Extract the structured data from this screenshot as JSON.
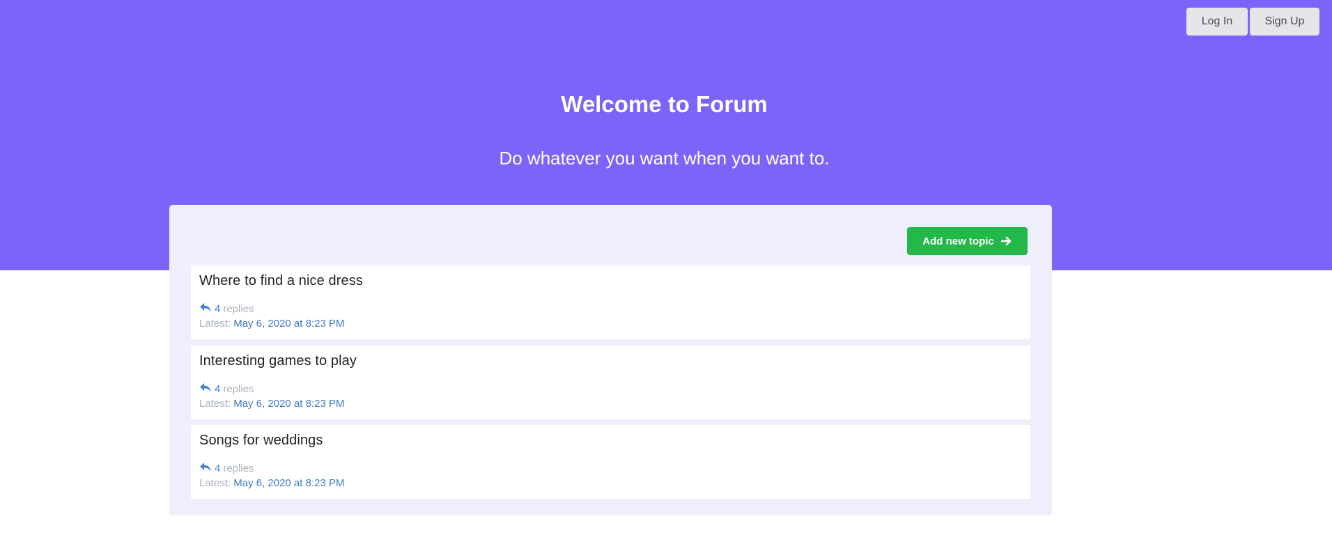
{
  "header": {
    "login_label": "Log In",
    "signup_label": "Sign Up",
    "title": "Welcome to Forum",
    "subtitle": "Do whatever you want when you want to."
  },
  "toolbar": {
    "add_topic_label": "Add new topic"
  },
  "topics": [
    {
      "title": "Where to find a nice dress",
      "replies_count": "4",
      "replies_label": "replies",
      "latest_label": "Latest:",
      "latest_date": "May 6, 2020 at 8:23 PM"
    },
    {
      "title": "Interesting games to play",
      "replies_count": "4",
      "replies_label": "replies",
      "latest_label": "Latest:",
      "latest_date": "May 6, 2020 at 8:23 PM"
    },
    {
      "title": "Songs for weddings",
      "replies_count": "4",
      "replies_label": "replies",
      "latest_label": "Latest:",
      "latest_date": "May 6, 2020 at 8:23 PM"
    }
  ],
  "icons": {
    "reply": "reply-icon",
    "arrow": "arrow-right-icon"
  },
  "colors": {
    "hero": "#7b65f9",
    "panel": "#efeefc",
    "add_button": "#23b84a",
    "link": "#3b7bc3"
  }
}
